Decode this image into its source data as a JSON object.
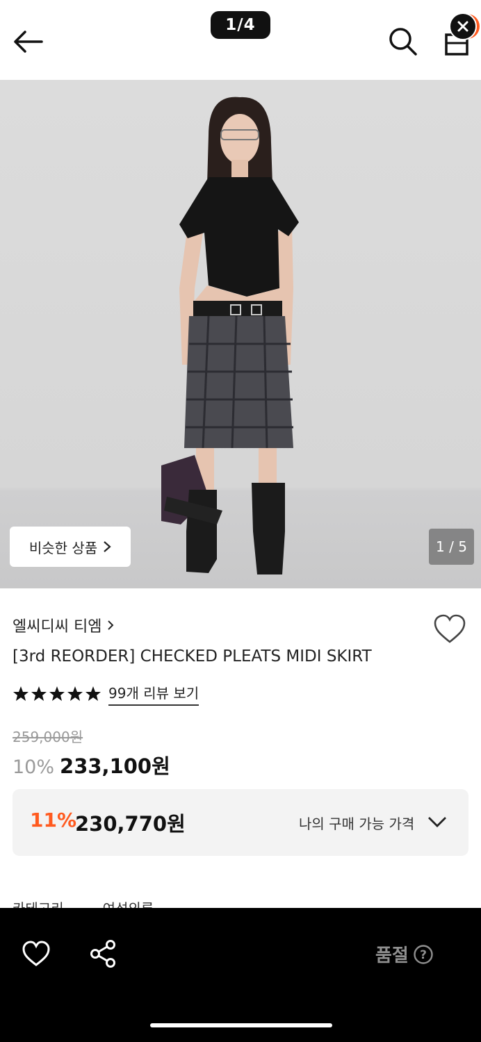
{
  "top_bar": {
    "image_counter": "1/4"
  },
  "gallery": {
    "similar_button_label": "비슷한 상품",
    "image_counter": "1 / 5"
  },
  "product": {
    "brand": "엘씨디씨 티엠",
    "title": "[3rd REORDER] CHECKED PLEATS MIDI SKIRT",
    "rating_stars": 5,
    "review_link": "99개 리뷰 보기",
    "original_price": "259,000원",
    "discount_percent": "10%",
    "sale_price": "233,100원"
  },
  "my_price": {
    "discount_percent": "11%",
    "price": "230,770원",
    "label": "나의 구매 가능 가격"
  },
  "category_peek": {
    "items": [
      "카테고리",
      "여성의류"
    ]
  },
  "bottom_bar": {
    "status": "품절",
    "help_icon": "?"
  },
  "colors": {
    "accent": "#ff5a1f",
    "bottom_bar": "#000000",
    "muted": "#9a9a9a"
  },
  "icons": [
    "back-arrow-icon",
    "search-icon",
    "shopping-bag-icon",
    "close-icon",
    "chevron-right-icon",
    "heart-icon",
    "star-icon",
    "chevron-down-icon",
    "share-icon",
    "help-icon"
  ]
}
